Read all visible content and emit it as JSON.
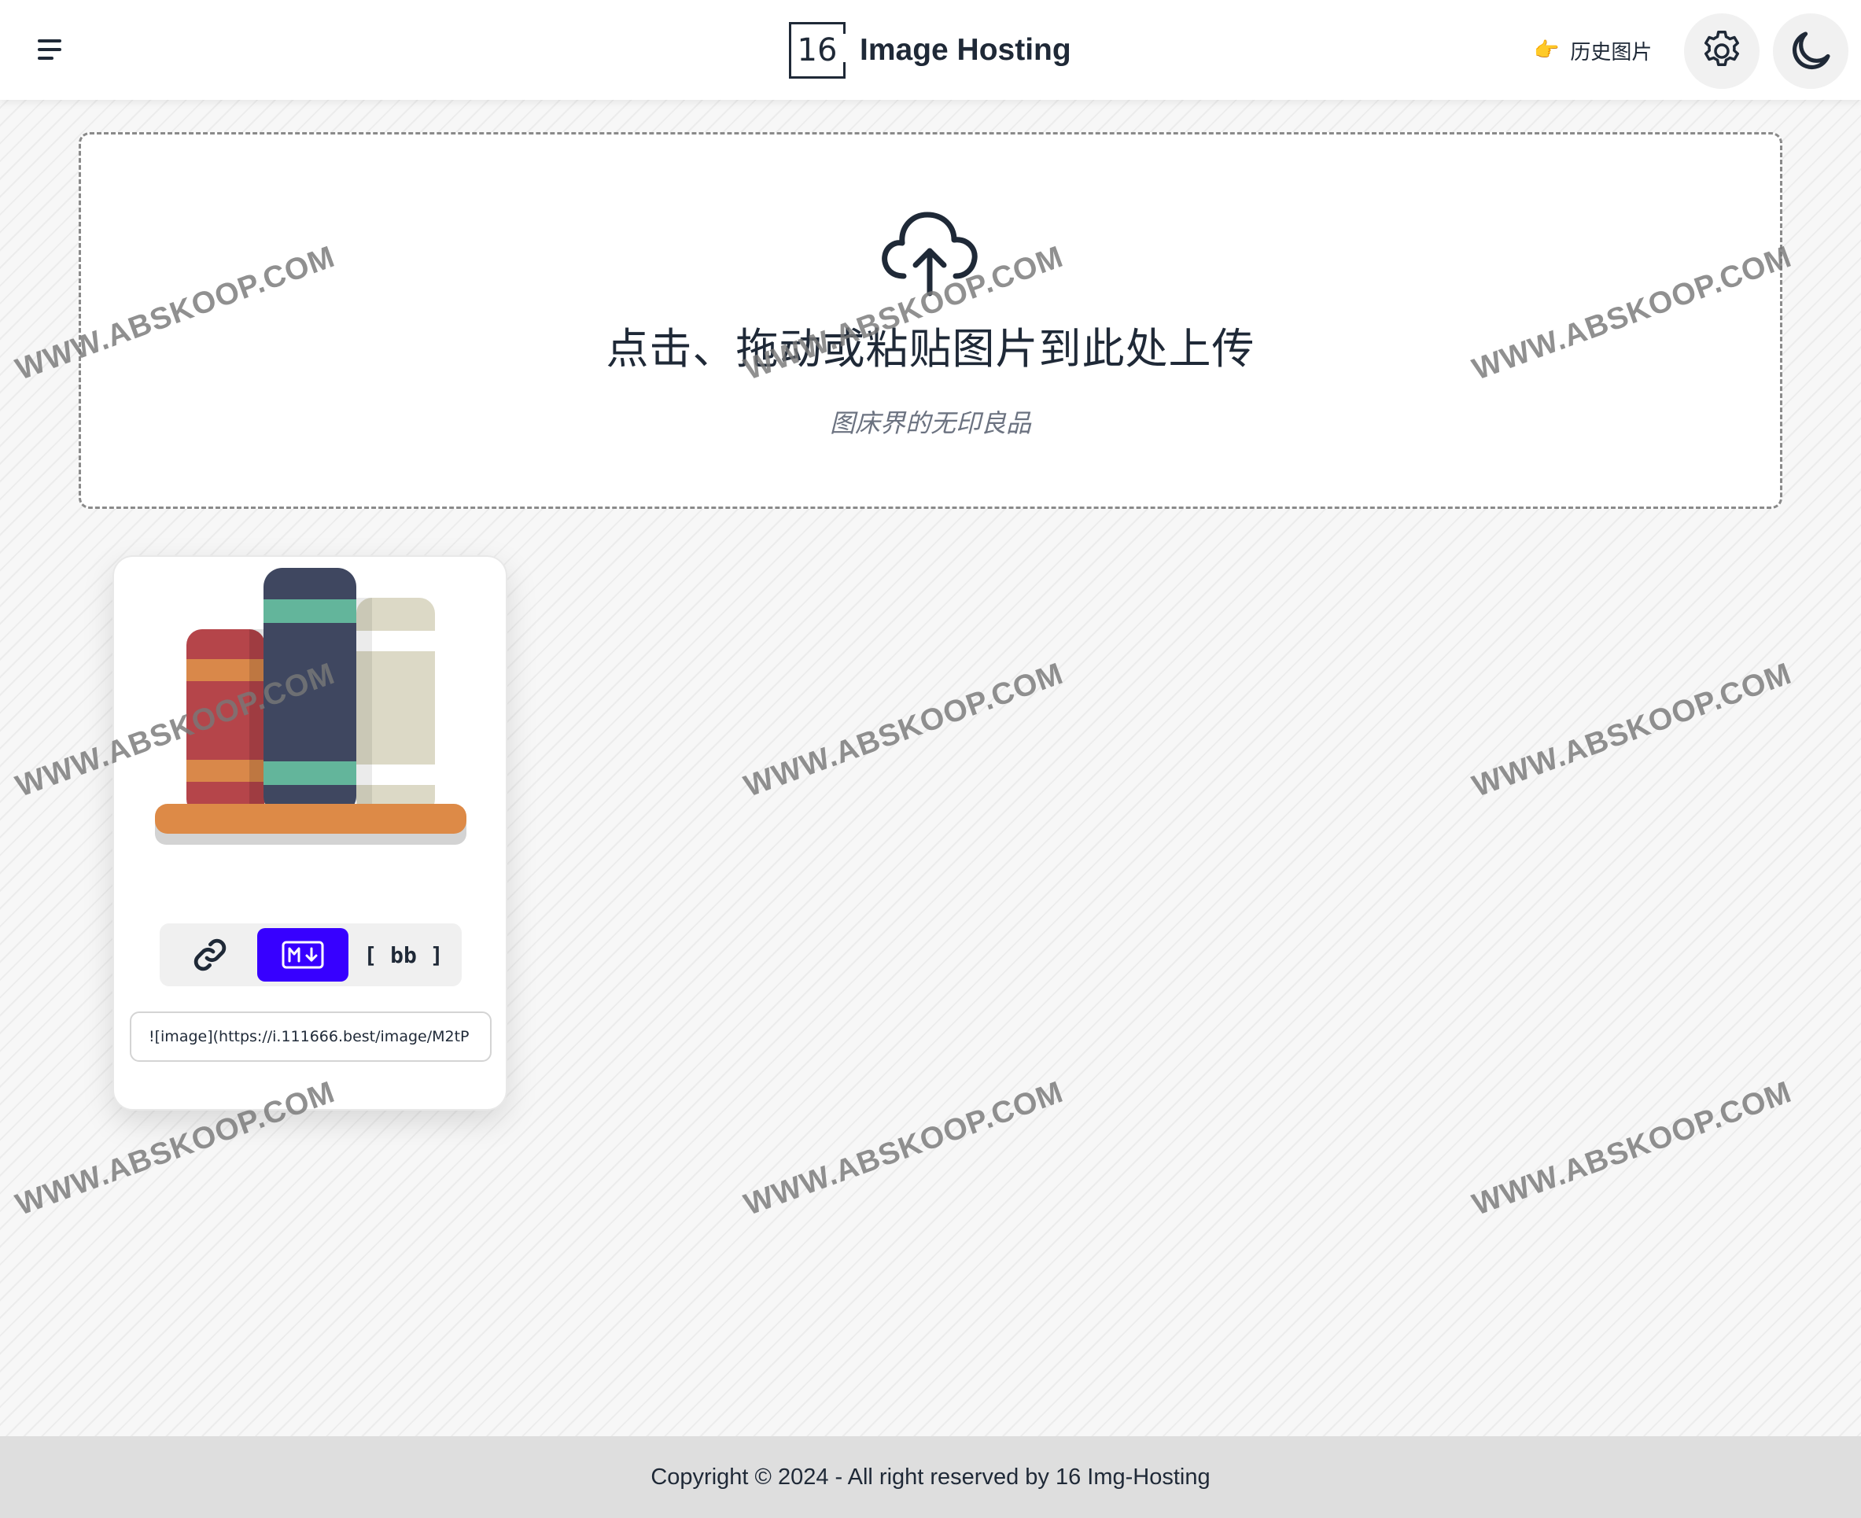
{
  "header": {
    "logo_number": "16",
    "logo_text": "Image Hosting",
    "history_label": "历史图片",
    "history_icon": "👉"
  },
  "dropzone": {
    "title": "点击、拖动或粘贴图片到此处上传",
    "subtitle": "图床界的无印良品"
  },
  "card": {
    "formats": {
      "link_label": "link",
      "markdown_label": "M↓",
      "bbcode_label": "[ bb ]",
      "selected": "markdown"
    },
    "url_value": "![image](https://i.111666.best/image/M2tP"
  },
  "footer": {
    "copyright": "Copyright © 2024 - All right reserved by 16 Img-Hosting"
  },
  "watermark": {
    "text": "WWW.ABSKOOP.COM"
  },
  "colors": {
    "accent": "#3700ff",
    "text": "#1f2937",
    "footer_bg": "#dedede"
  }
}
